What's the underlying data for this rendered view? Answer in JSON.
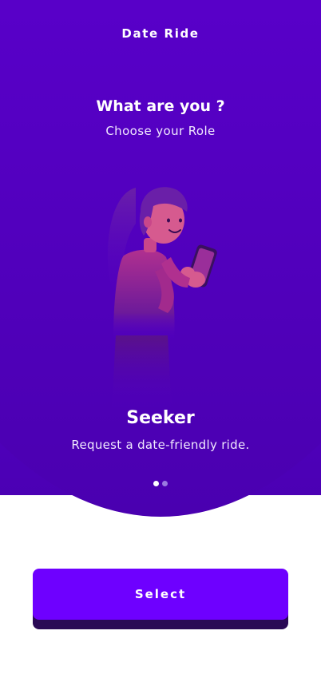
{
  "header": {
    "app_title": "Date Ride"
  },
  "prompt": {
    "question": "What are you ?",
    "subtitle": "Choose your Role"
  },
  "carousel": {
    "role_name": "Seeker",
    "role_description": "Request a date-friendly ride.",
    "illustration_icon": "woman-with-phone-illustration",
    "page_count": 2,
    "active_page": 1
  },
  "actions": {
    "select_label": "Select"
  },
  "colors": {
    "primary": "#6e00ff",
    "hero_top": "#6400dd",
    "hero_bottom": "#4b00b4",
    "button_shadow": "#2a0a55",
    "dot_active": "#ffffff",
    "dot_inactive": "#9a7be0"
  }
}
